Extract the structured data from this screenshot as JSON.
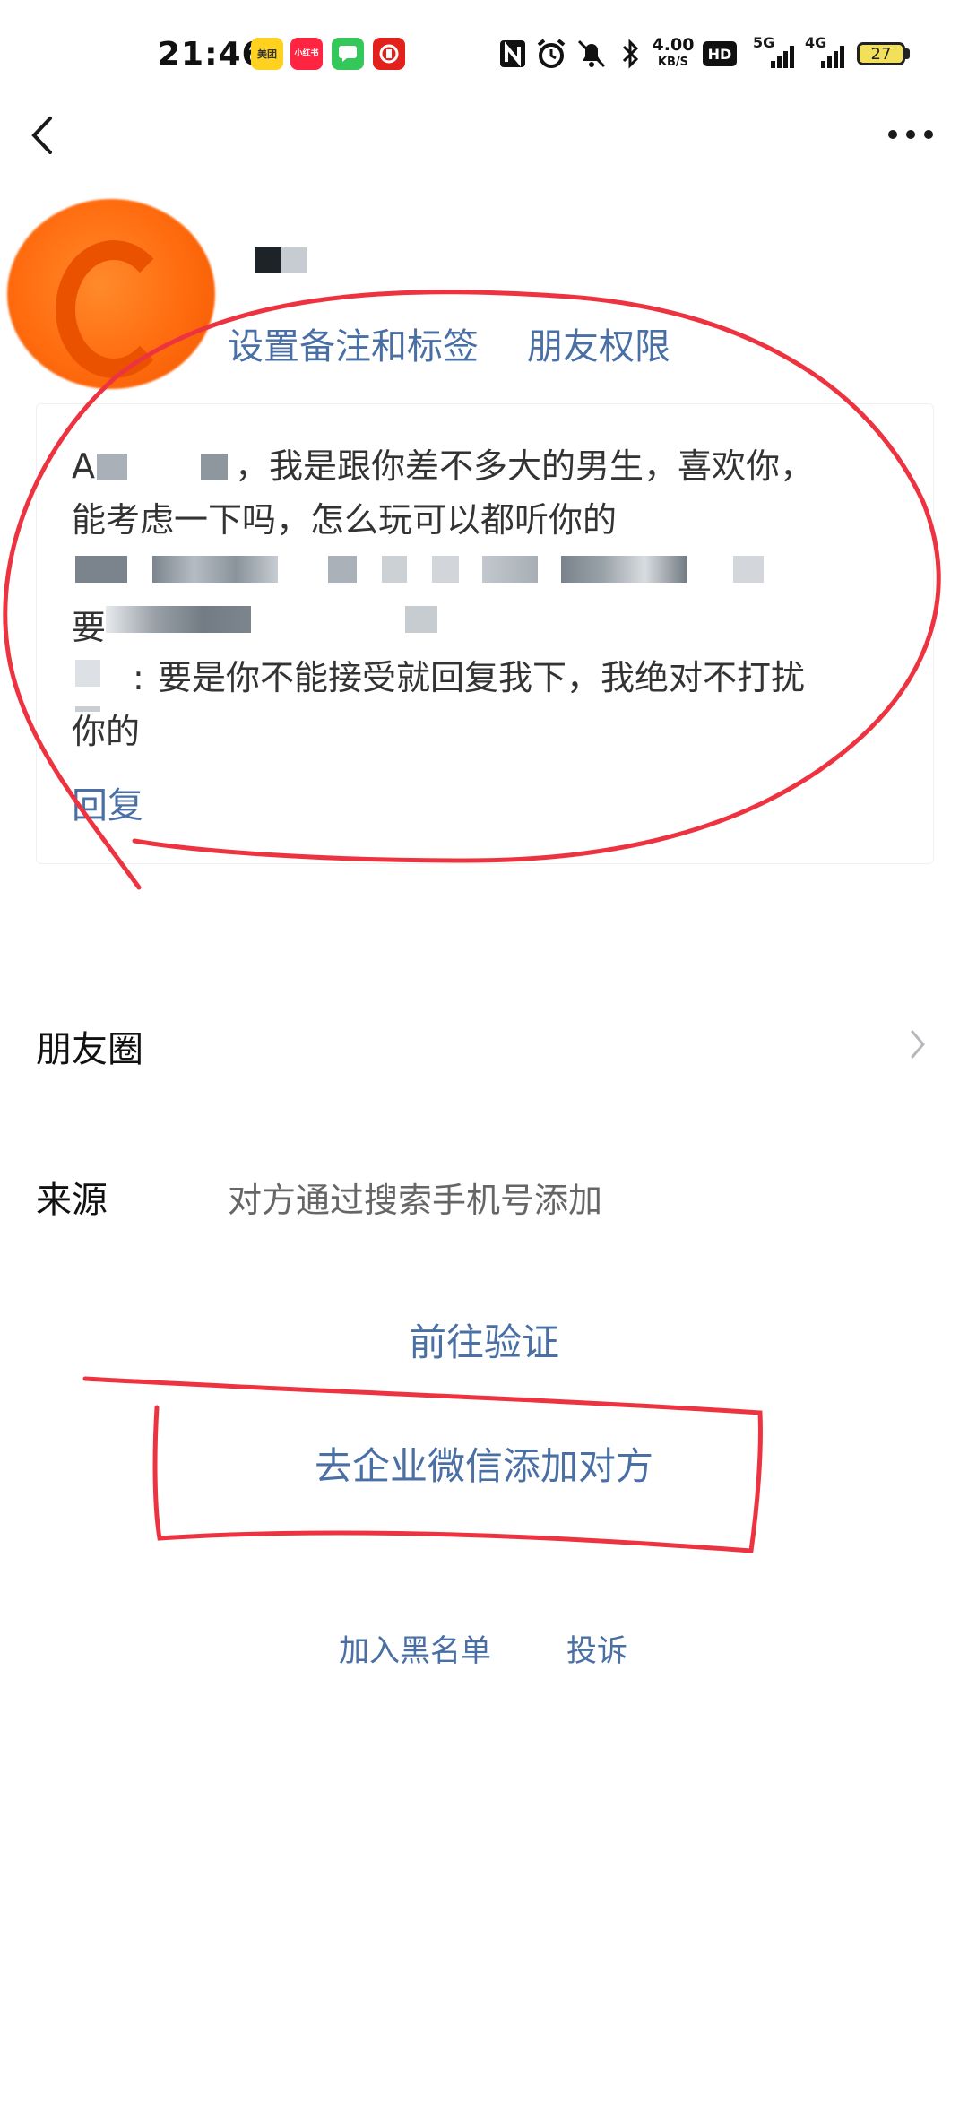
{
  "status_bar": {
    "time": "21:46",
    "apps": [
      {
        "name": "meituan-app-icon",
        "label": "美团",
        "color": "#ffd21f"
      },
      {
        "name": "xiaohongshu-app-icon",
        "label": "小红书",
        "color": "#ff2442"
      },
      {
        "name": "messages-app-icon",
        "label": "",
        "color": "#34c759"
      },
      {
        "name": "bank-app-icon",
        "label": "",
        "color": "#e3211c"
      }
    ],
    "net_speed": "4.00",
    "net_unit": "KB/S",
    "hd_label": "HD",
    "net1": "5G",
    "net2": "4G",
    "battery": "27"
  },
  "profile": {
    "remark_link": "设置备注和标签",
    "permission_link": "朋友权限"
  },
  "request": {
    "line1": "，我是跟你差不多大的男生，喜欢你，",
    "line1_prefix": "A",
    "line2": "能考虑一下吗，怎么玩可以都听你的",
    "line4_prefix": "要",
    "line5": "要是你不能接受就回复我下，我绝对不打扰",
    "line6": "你的",
    "reply": "回复"
  },
  "moments": {
    "label": "朋友圈"
  },
  "source": {
    "label": "来源",
    "value": "对方通过搜索手机号添加"
  },
  "actions": {
    "verify": "前往验证",
    "wecom_add": "去企业微信添加对方",
    "blacklist": "加入黑名单",
    "report": "投诉"
  },
  "colors": {
    "link": "#4a6fa5",
    "annotation": "#ee3340",
    "avatar": "#ff6b0f"
  }
}
